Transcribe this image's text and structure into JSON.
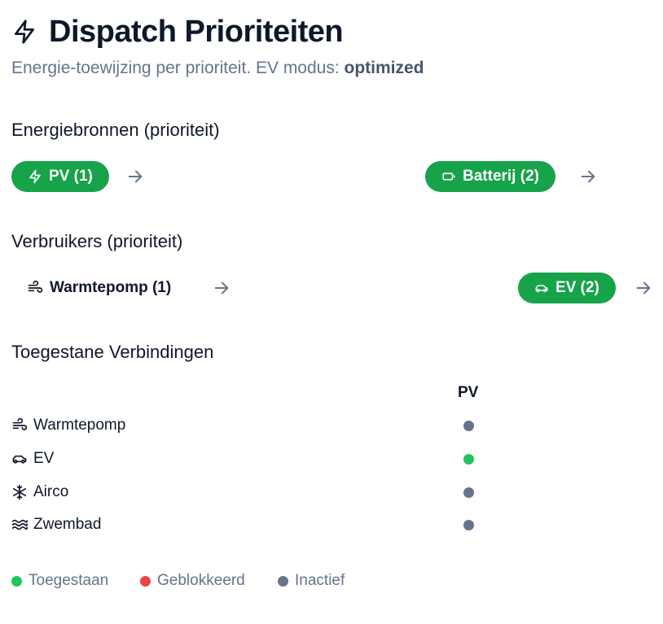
{
  "header": {
    "title": "Dispatch Prioriteiten",
    "subtitle_prefix": "Energie-toewijzing per prioriteit. EV modus: ",
    "ev_mode": "optimized"
  },
  "sources": {
    "heading": "Energiebronnen (prioriteit)",
    "items": [
      {
        "label": "PV (1)",
        "icon": "lightning-icon",
        "active": true
      },
      {
        "label": "Batterij (2)",
        "icon": "battery-icon",
        "active": true
      }
    ]
  },
  "consumers": {
    "heading": "Verbruikers (prioriteit)",
    "items": [
      {
        "label": "Warmtepomp (1)",
        "icon": "wind-icon",
        "active": false
      },
      {
        "label": "EV (2)",
        "icon": "car-icon",
        "active": true
      }
    ]
  },
  "connections": {
    "heading": "Toegestane Verbindingen",
    "column_header": "PV",
    "rows": [
      {
        "label": "Warmtepomp",
        "icon": "wind-icon",
        "status": "inactive"
      },
      {
        "label": "EV",
        "icon": "car-icon",
        "status": "allowed"
      },
      {
        "label": "Airco",
        "icon": "snowflake-icon",
        "status": "inactive"
      },
      {
        "label": "Zwembad",
        "icon": "waves-icon",
        "status": "inactive"
      }
    ]
  },
  "legend": {
    "allowed": "Toegestaan",
    "blocked": "Geblokkeerd",
    "inactive": "Inactief"
  },
  "colors": {
    "active_pill": "#16a34a",
    "allowed": "#22c55e",
    "blocked": "#ef4444",
    "inactive": "#64748b",
    "arrow": "#64748b"
  }
}
